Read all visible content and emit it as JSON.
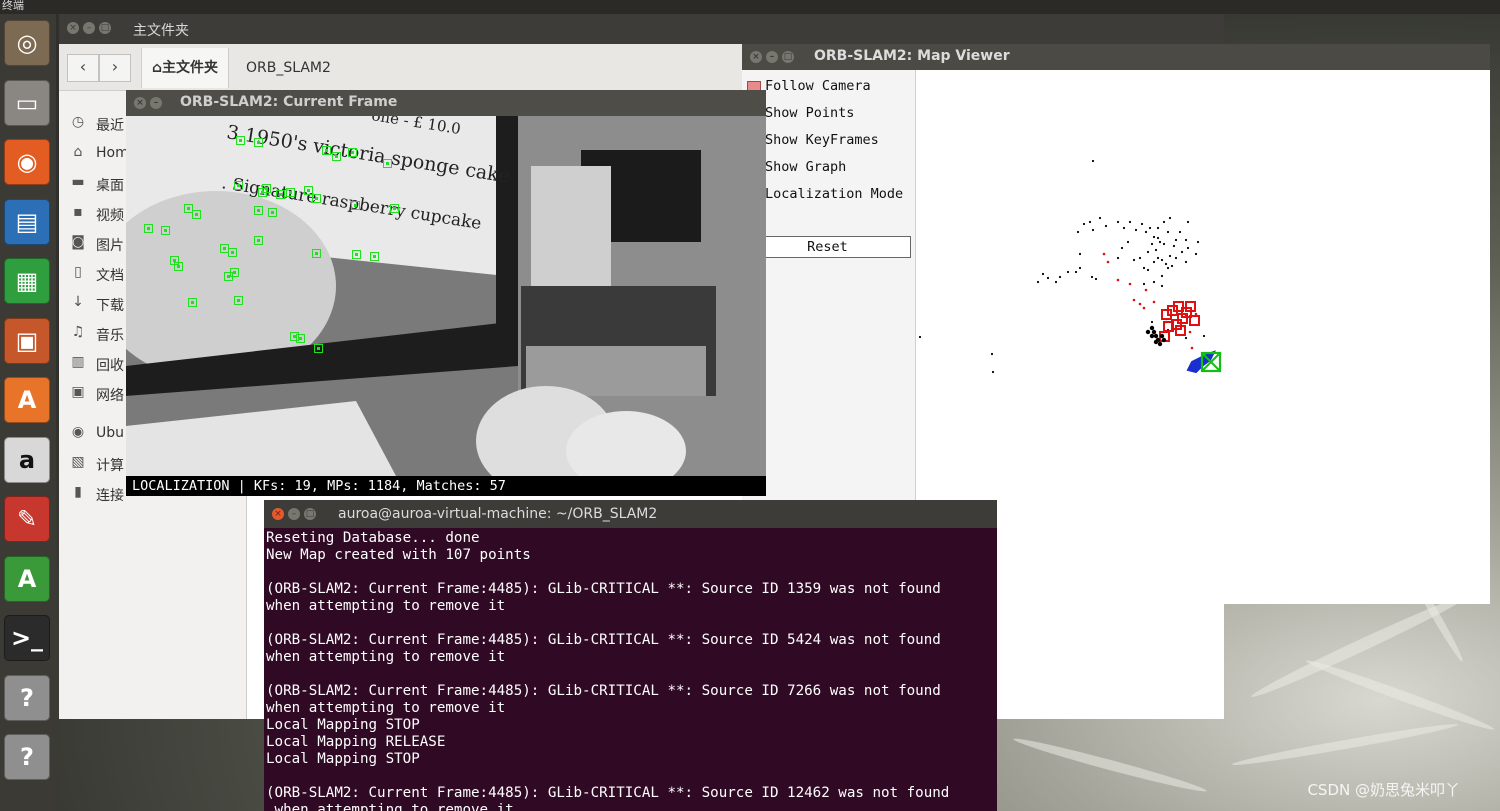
{
  "top_bar": {
    "title": "终端"
  },
  "launcher": {
    "items": [
      {
        "name": "ubuntu-dash",
        "icon": "ubuntu-logo-icon",
        "color": "#7d6a52"
      },
      {
        "name": "files",
        "icon": "file-cabinet-icon",
        "color": "#8a8782"
      },
      {
        "name": "firefox",
        "icon": "firefox-icon",
        "color": "#e35c21"
      },
      {
        "name": "writer",
        "icon": "writer-doc-icon",
        "color": "#2c6fb6"
      },
      {
        "name": "calc",
        "icon": "calc-sheet-icon",
        "color": "#2f9e3e"
      },
      {
        "name": "impress",
        "icon": "impress-slide-icon",
        "color": "#c5572a"
      },
      {
        "name": "software-center",
        "icon": "shopping-bag-icon",
        "color": "#e8742a"
      },
      {
        "name": "amazon",
        "icon": "amazon-icon",
        "color": "#d8d8d8"
      },
      {
        "name": "system-settings",
        "icon": "wrench-gear-icon",
        "color": "#c8372d"
      },
      {
        "name": "software-updater",
        "icon": "updater-icon",
        "color": "#3a9a3a"
      },
      {
        "name": "terminal",
        "icon": "terminal-icon",
        "color": "#2b2b2b"
      },
      {
        "name": "unknown-app-1",
        "icon": "question-icon",
        "color": "#8f8f8f"
      },
      {
        "name": "unknown-app-2",
        "icon": "question-icon",
        "color": "#8f8f8f"
      }
    ],
    "glyphs": [
      "◎",
      "▭",
      "◉",
      "▤",
      "▦",
      "▣",
      "A",
      "a",
      "✎",
      "A",
      ">_",
      "?",
      "?"
    ]
  },
  "file_manager": {
    "title": "主文件夹",
    "breadcrumbs": [
      {
        "label": "主文件夹",
        "icon": "home-icon"
      },
      {
        "label": "ORB_SLAM2"
      }
    ],
    "sidebar": [
      {
        "label": "最近",
        "icon": "clock-icon",
        "glyph": "◷"
      },
      {
        "label": "Hom",
        "icon": "home-icon",
        "glyph": "⌂"
      },
      {
        "label": "桌面",
        "icon": "folder-icon",
        "glyph": "▬"
      },
      {
        "label": "视频",
        "icon": "video-icon",
        "glyph": "▪"
      },
      {
        "label": "图片",
        "icon": "camera-icon",
        "glyph": "◙"
      },
      {
        "label": "文档",
        "icon": "document-icon",
        "glyph": "▯"
      },
      {
        "label": "下载",
        "icon": "download-icon",
        "glyph": "↓"
      },
      {
        "label": "音乐",
        "icon": "music-icon",
        "glyph": "♫"
      },
      {
        "label": "回收",
        "icon": "trash-icon",
        "glyph": "▥"
      },
      {
        "label": "网络",
        "icon": "network-icon",
        "glyph": "▣"
      },
      {
        "label": "Ubu",
        "icon": "disc-icon",
        "glyph": "◉"
      },
      {
        "label": "计算",
        "icon": "computer-icon",
        "glyph": "▧"
      },
      {
        "label": "连接",
        "icon": "server-icon",
        "glyph": "▮"
      }
    ]
  },
  "current_frame": {
    "title": "ORB-SLAM2: Current Frame",
    "status": "LOCALIZATION | KFs: 19, MPs: 1184, Matches: 57",
    "scene_text": [
      "3 1950's victoria sponge cake",
      ". Signature raspberry cupcake",
      "one - £ 10.0"
    ]
  },
  "map_viewer": {
    "title": "ORB-SLAM2: Map Viewer",
    "options": [
      {
        "label": "Follow Camera",
        "checked": true
      },
      {
        "label": "Show Points",
        "checked": false
      },
      {
        "label": "Show KeyFrames",
        "checked": false
      },
      {
        "label": "Show Graph",
        "checked": false
      },
      {
        "label": "Localization Mode",
        "checked": false
      }
    ],
    "reset_label": "Reset",
    "colors": {
      "keyframes": "#e01010",
      "current_camera": "#10c010",
      "trajectory": "#1a2fd0",
      "points": "#000000"
    }
  },
  "terminal": {
    "title": "auroa@auroa-virtual-machine: ~/ORB_SLAM2",
    "lines": [
      "Reseting Database... done",
      "New Map created with 107 points",
      "",
      "(ORB-SLAM2: Current Frame:4485): GLib-CRITICAL **: Source ID 1359 was not found",
      "when attempting to remove it",
      "",
      "(ORB-SLAM2: Current Frame:4485): GLib-CRITICAL **: Source ID 5424 was not found",
      "when attempting to remove it",
      "",
      "(ORB-SLAM2: Current Frame:4485): GLib-CRITICAL **: Source ID 7266 was not found",
      "when attempting to remove it",
      "Local Mapping STOP",
      "Local Mapping RELEASE",
      "Local Mapping STOP",
      "",
      "(ORB-SLAM2: Current Frame:4485): GLib-CRITICAL **: Source ID 12462 was not found",
      " when attempting to remove it"
    ]
  },
  "watermark": "CSDN @奶思兔米叩丫"
}
